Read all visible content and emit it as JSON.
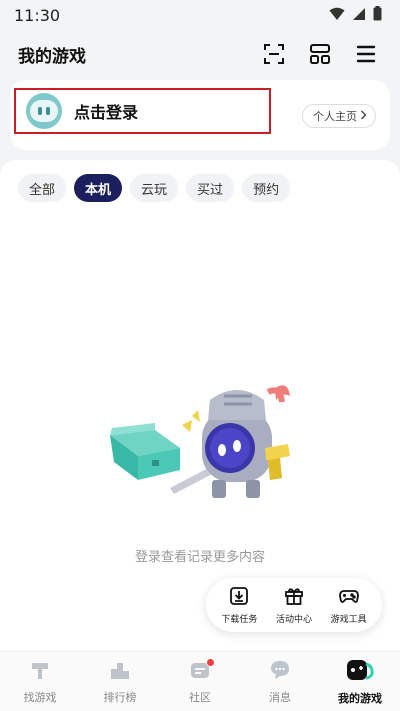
{
  "status_bar": {
    "time": "11:30"
  },
  "header": {
    "title": "我的游戏"
  },
  "login": {
    "text": "点击登录",
    "profile_label": "个人主页"
  },
  "tabs": [
    {
      "label": "全部",
      "active": false
    },
    {
      "label": "本机",
      "active": true
    },
    {
      "label": "云玩",
      "active": false
    },
    {
      "label": "买过",
      "active": false
    },
    {
      "label": "预约",
      "active": false
    }
  ],
  "empty": {
    "text": "登录查看记录更多内容"
  },
  "tools": [
    {
      "label": "下载任务",
      "icon": "download-icon"
    },
    {
      "label": "活动中心",
      "icon": "gift-icon"
    },
    {
      "label": "游戏工具",
      "icon": "gamepad-icon"
    }
  ],
  "bottom_nav": [
    {
      "label": "找游戏",
      "icon": "hammer-icon",
      "active": false
    },
    {
      "label": "排行榜",
      "icon": "podium-icon",
      "active": false
    },
    {
      "label": "社区",
      "icon": "community-icon",
      "active": false,
      "badge": true
    },
    {
      "label": "消息",
      "icon": "chat-bubble-icon",
      "active": false
    },
    {
      "label": "我的游戏",
      "icon": "my-games-icon",
      "active": true
    }
  ],
  "colors": {
    "accent_dark": "#1c1f5e",
    "highlight_box": "#c81e28",
    "badge": "#ee3b3b",
    "avatar": "#7fc8cb"
  }
}
